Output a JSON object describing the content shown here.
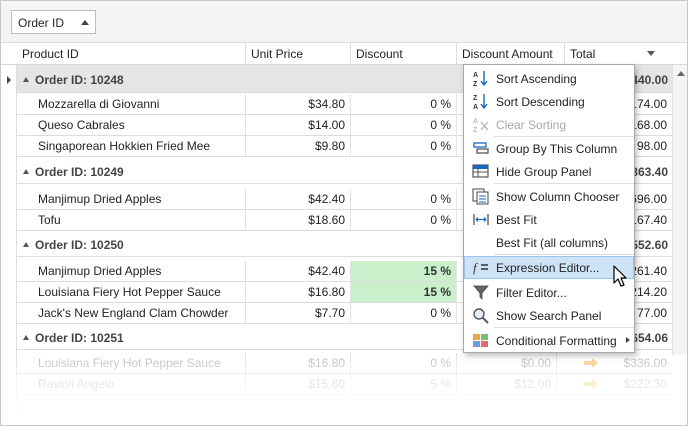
{
  "group_panel": {
    "chip_label": "Order ID"
  },
  "columns": [
    "Product ID",
    "Unit Price",
    "Discount",
    "Discount Amount",
    "Total"
  ],
  "groups": [
    {
      "title": "Order ID: 10248",
      "total": "440.00",
      "rows": [
        {
          "product": "Mozzarella di Giovanni",
          "price": "$34.80",
          "discount": "0 %",
          "amount": "",
          "total": "174.00"
        },
        {
          "product": "Queso Cabrales",
          "price": "$14.00",
          "discount": "0 %",
          "amount": "",
          "total": "168.00"
        },
        {
          "product": "Singaporean Hokkien Fried Mee",
          "price": "$9.80",
          "discount": "0 %",
          "amount": "",
          "total": "98.00"
        }
      ]
    },
    {
      "title": "Order ID: 10249",
      "total": "863.40",
      "rows": [
        {
          "product": "Manjimup Dried Apples",
          "price": "$42.40",
          "discount": "0 %",
          "amount": "",
          "total": "696.00"
        },
        {
          "product": "Tofu",
          "price": "$18.60",
          "discount": "0 %",
          "amount": "",
          "total": "167.40"
        }
      ]
    },
    {
      "title": "Order ID: 10250",
      "total": "1552.60",
      "rows": [
        {
          "product": "Manjimup Dried Apples",
          "price": "$42.40",
          "discount": "15 %",
          "amount": "",
          "total": "1261.40"
        },
        {
          "product": "Louisiana Fiery Hot Pepper Sauce",
          "price": "$16.80",
          "discount": "15 %",
          "amount": "",
          "total": "214.20"
        },
        {
          "product": "Jack's New England Clam Chowder",
          "price": "$7.70",
          "discount": "0 %",
          "amount": "",
          "total": "77.00"
        }
      ]
    },
    {
      "title": "Order ID: 10251",
      "total": "654.06",
      "rows": [
        {
          "product": "Louisiana Fiery Hot Pepper Sauce",
          "price": "$16.80",
          "discount": "0 %",
          "amount": "$0.00",
          "total": "$336.00"
        },
        {
          "product": "Ravioli Angelo",
          "price": "$15.60",
          "discount": "5 %",
          "amount": "$12.00",
          "total": "$222.30"
        }
      ]
    }
  ],
  "menu": [
    {
      "label": "Sort Ascending",
      "icon": "sort-ascending-icon",
      "disabled": false
    },
    {
      "label": "Sort Descending",
      "icon": "sort-descending-icon",
      "disabled": false
    },
    {
      "label": "Clear Sorting",
      "icon": "clear-sorting-icon",
      "disabled": true
    },
    {
      "label": "Group By This Column",
      "icon": "group-by-icon",
      "disabled": false
    },
    {
      "label": "Hide Group Panel",
      "icon": "group-panel-icon",
      "disabled": false
    },
    {
      "label": "Show Column Chooser",
      "icon": "column-chooser-icon",
      "disabled": false
    },
    {
      "label": "Best Fit",
      "icon": "best-fit-icon",
      "disabled": false
    },
    {
      "label": "Best Fit (all columns)",
      "icon": "",
      "disabled": false
    },
    {
      "label": "Expression Editor...",
      "icon": "expression-editor-icon",
      "disabled": false,
      "hover": true
    },
    {
      "label": "Filter Editor...",
      "icon": "filter-icon",
      "disabled": false
    },
    {
      "label": "Show Search Panel",
      "icon": "search-icon",
      "disabled": false
    },
    {
      "label": "Conditional Formatting",
      "icon": "conditional-formatting-icon",
      "disabled": false,
      "submenu": true
    }
  ],
  "colors": {
    "highlight_green": "#c9efcb",
    "menu_hover": "#cfe3f7",
    "arrow_orange": "#f0b64a"
  }
}
